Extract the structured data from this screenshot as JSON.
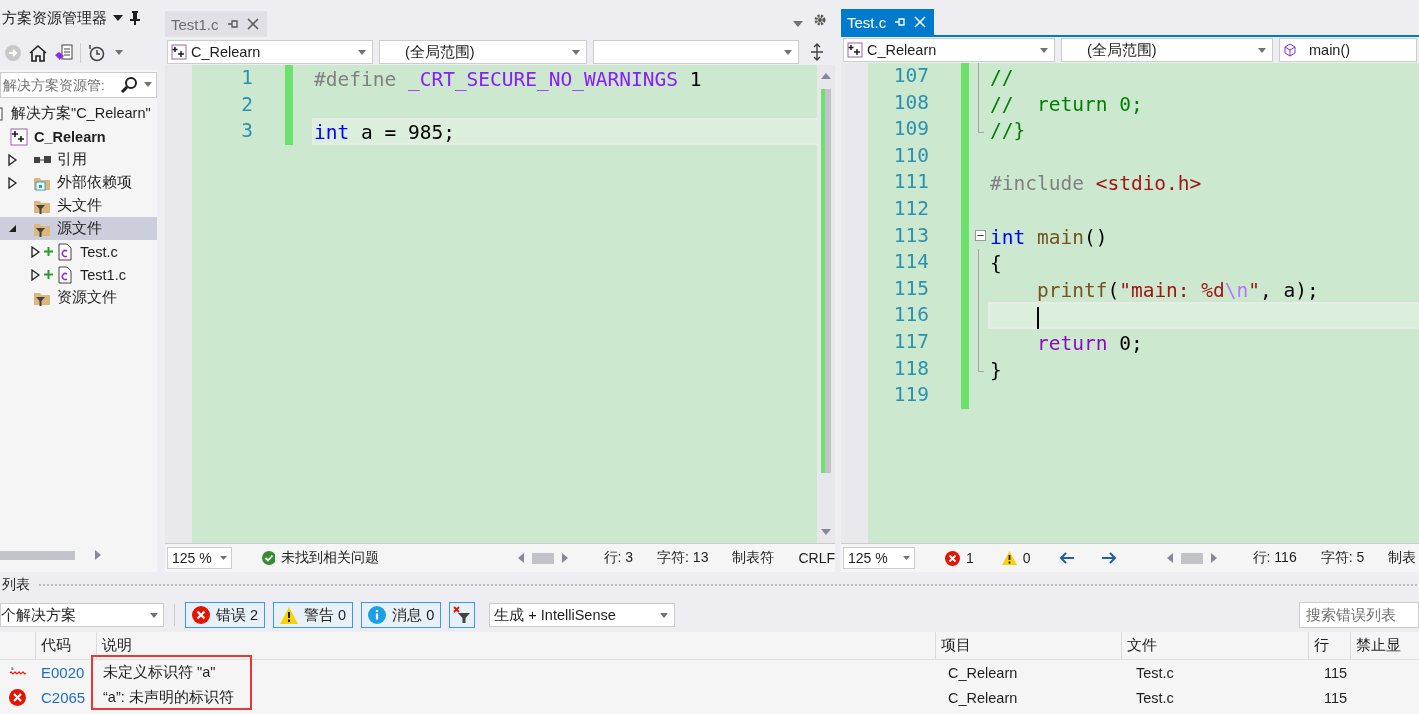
{
  "solution_explorer": {
    "title": "方案资源管理器",
    "search": {
      "placeholder": "解决方案资源管:"
    },
    "tree": [
      {
        "label": "解决方案\"C_Relearn\"",
        "kind": "solution",
        "selected": false,
        "children": [
          {
            "label": "C_Relearn",
            "kind": "project",
            "selected": false,
            "children": [
              {
                "label": "引用",
                "kind": "references",
                "selected": false,
                "expanded": false
              },
              {
                "label": "外部依赖项",
                "kind": "dependencies",
                "selected": false,
                "expanded": false
              },
              {
                "label": "头文件",
                "kind": "filter",
                "selected": false
              },
              {
                "label": "源文件",
                "kind": "filter",
                "selected": true,
                "expanded": true,
                "children": [
                  {
                    "label": "Test.c",
                    "kind": "file",
                    "selected": false,
                    "expanded": false,
                    "added": true
                  },
                  {
                    "label": "Test1.c",
                    "kind": "file",
                    "selected": false,
                    "expanded": false,
                    "added": true
                  }
                ]
              },
              {
                "label": "资源文件",
                "kind": "filter",
                "selected": false
              }
            ]
          }
        ]
      }
    ]
  },
  "editors": [
    {
      "tab": {
        "label": "Test1.c",
        "selected": false
      },
      "nav": {
        "project": "C_Relearn",
        "scope": "(全局范围)"
      },
      "lines": [
        {
          "number": "1",
          "changed": true,
          "tokens": [
            {
              "kind": "preproc",
              "text": "#define "
            },
            {
              "kind": "macro",
              "text": "_CRT_SECURE_NO_WARNINGS"
            },
            {
              "kind": "plain",
              "text": " 1"
            }
          ]
        },
        {
          "number": "2",
          "changed": true
        },
        {
          "number": "3",
          "changed": true,
          "current": true,
          "tokens": [
            {
              "kind": "keyword",
              "text": "int"
            },
            {
              "kind": "plain",
              "text": " a = 985;"
            }
          ]
        }
      ],
      "status": {
        "zoom": "125 %",
        "issues": {
          "kind": "none",
          "text": "未找到相关问题"
        },
        "line": "行: 3",
        "col": "字符: 13",
        "tabs": "制表符",
        "eol": "CRLF"
      }
    },
    {
      "tab": {
        "label": "Test.c",
        "selected": true
      },
      "nav": {
        "project": "C_Relearn",
        "scope": "(全局范围)",
        "member": "main()"
      },
      "lines": [
        {
          "number": "107",
          "changed": true,
          "in_block": true,
          "tokens": [
            {
              "kind": "comment",
              "text": "//"
            }
          ]
        },
        {
          "number": "108",
          "changed": true,
          "in_block": true,
          "tokens": [
            {
              "kind": "comment",
              "text": "//  return 0;"
            }
          ]
        },
        {
          "number": "109",
          "changed": true,
          "block_end": true,
          "tokens": [
            {
              "kind": "comment",
              "text": "//}"
            }
          ]
        },
        {
          "number": "110",
          "changed": true
        },
        {
          "number": "111",
          "changed": true,
          "tokens": [
            {
              "kind": "preproc",
              "text": "#include "
            },
            {
              "kind": "string",
              "text": "<stdio.h>"
            }
          ]
        },
        {
          "number": "112",
          "changed": true
        },
        {
          "number": "113",
          "changed": true,
          "collapsible": true,
          "tokens": [
            {
              "kind": "keyword",
              "text": "int"
            },
            {
              "kind": "func",
              "text": " main"
            },
            {
              "kind": "plain",
              "text": "()"
            }
          ]
        },
        {
          "number": "114",
          "changed": true,
          "in_block": true,
          "tokens": [
            {
              "kind": "plain",
              "text": "{"
            }
          ]
        },
        {
          "number": "115",
          "changed": true,
          "in_block": true,
          "tokens": [
            {
              "kind": "func",
              "text": "    printf"
            },
            {
              "kind": "plain",
              "text": "("
            },
            {
              "kind": "string",
              "text": "\"main: %d"
            },
            {
              "kind": "escape",
              "text": "\\n"
            },
            {
              "kind": "string",
              "text": "\""
            },
            {
              "kind": "plain",
              "text": ", "
            },
            {
              "kind": "undefined",
              "text": "a"
            },
            {
              "kind": "plain",
              "text": ");"
            }
          ]
        },
        {
          "number": "116",
          "changed": true,
          "current": true,
          "caret": true,
          "in_block": true
        },
        {
          "number": "117",
          "changed": true,
          "in_block": true,
          "tokens": [
            {
              "kind": "control",
              "text": "    return"
            },
            {
              "kind": "plain",
              "text": " 0;"
            }
          ]
        },
        {
          "number": "118",
          "changed": true,
          "block_end": true,
          "tokens": [
            {
              "kind": "plain",
              "text": "}"
            }
          ]
        },
        {
          "number": "119",
          "changed": true
        }
      ],
      "status": {
        "zoom": "125 %",
        "issues": {
          "kind": "counts",
          "errors": "1",
          "warnings": "0"
        },
        "line": "行: 116",
        "col": "字符: 5",
        "tabs": "制表"
      }
    }
  ],
  "error_list": {
    "title": "列表",
    "scope": "个解决方案",
    "filters": [
      {
        "kind": "error",
        "label": "错误 2",
        "selected": true
      },
      {
        "kind": "warning",
        "label": "警告 0",
        "selected": true
      },
      {
        "kind": "message",
        "label": "消息 0",
        "selected": true
      }
    ],
    "source": "生成 + IntelliSense",
    "search": {
      "placeholder": "搜索错误列表"
    },
    "columns": [
      "代码",
      "说明",
      "项目",
      "文件",
      "行",
      "禁止显"
    ],
    "rows": [
      {
        "kind": "intellisense",
        "code": "E0020",
        "description": "未定义标识符 \"a\"",
        "project": "C_Relearn",
        "file": "Test.c",
        "line": "115"
      },
      {
        "kind": "error",
        "code": "C2065",
        "description": "“a”: 未声明的标识符",
        "project": "C_Relearn",
        "file": "Test.c",
        "line": "115"
      }
    ],
    "description_highlight": true
  }
}
